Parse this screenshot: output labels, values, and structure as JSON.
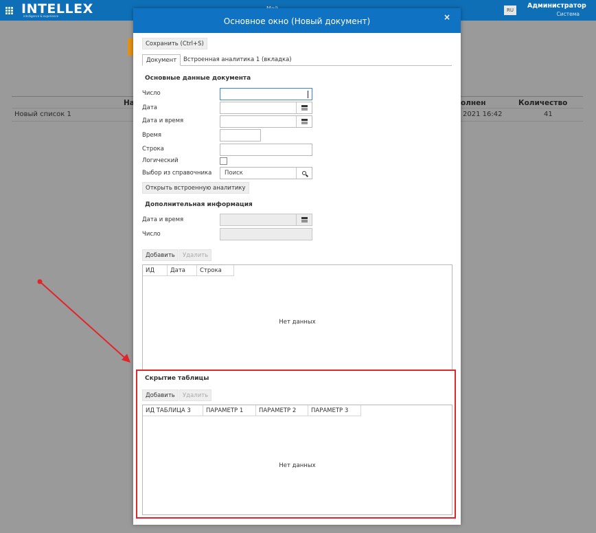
{
  "topbar": {
    "logo": "INTELLEX",
    "logo_sub": "intelligence & experience",
    "lang": "RU",
    "user_name": "Администратор",
    "user_role": "Система",
    "center_text": "Мой"
  },
  "background": {
    "col_name_header": "На",
    "col_done_header": "олнен",
    "col_qty_header": "Количество",
    "row_name": "Новый список 1",
    "row_done": "2021 16:42",
    "row_qty": "41"
  },
  "modal": {
    "title": "Основное окно (Новый документ)",
    "close": "×",
    "save_label": "Сохранить (Ctrl+S)",
    "tabs": [
      {
        "label": "Документ"
      },
      {
        "label": "Встроенная аналитика 1 (вкладка)"
      }
    ],
    "main_section": {
      "title": "Основные данные документа",
      "fields": {
        "number": "Число",
        "date": "Дата",
        "datetime": "Дата и время",
        "time": "Время",
        "string": "Строка",
        "boolean": "Логический",
        "lookup": "Выбор из справочника",
        "lookup_placeholder": "Поиск"
      },
      "open_analytics_label": "Открыть встроенную аналитику"
    },
    "extra_section": {
      "title": "Дополнительная информация",
      "datetime": "Дата и время",
      "number": "Число"
    },
    "table1": {
      "add_label": "Добавить",
      "delete_label": "Удалить",
      "columns": [
        "ИД",
        "Дата",
        "Строка"
      ],
      "empty": "Нет данных"
    },
    "table2": {
      "title": "Скрытие таблицы",
      "add_label": "Добавить",
      "delete_label": "Удалить",
      "columns": [
        "ИД ТАБЛИЦА 3",
        "ПАРАМЕТР 1",
        "ПАРАМЕТР 2",
        "ПАРАМЕТР 3"
      ],
      "empty": "Нет данных"
    }
  },
  "colors": {
    "topbar": "#0f6fb6",
    "modal_header": "#0f72c2",
    "highlight": "#e0252b",
    "accent_orange": "#e39116"
  }
}
